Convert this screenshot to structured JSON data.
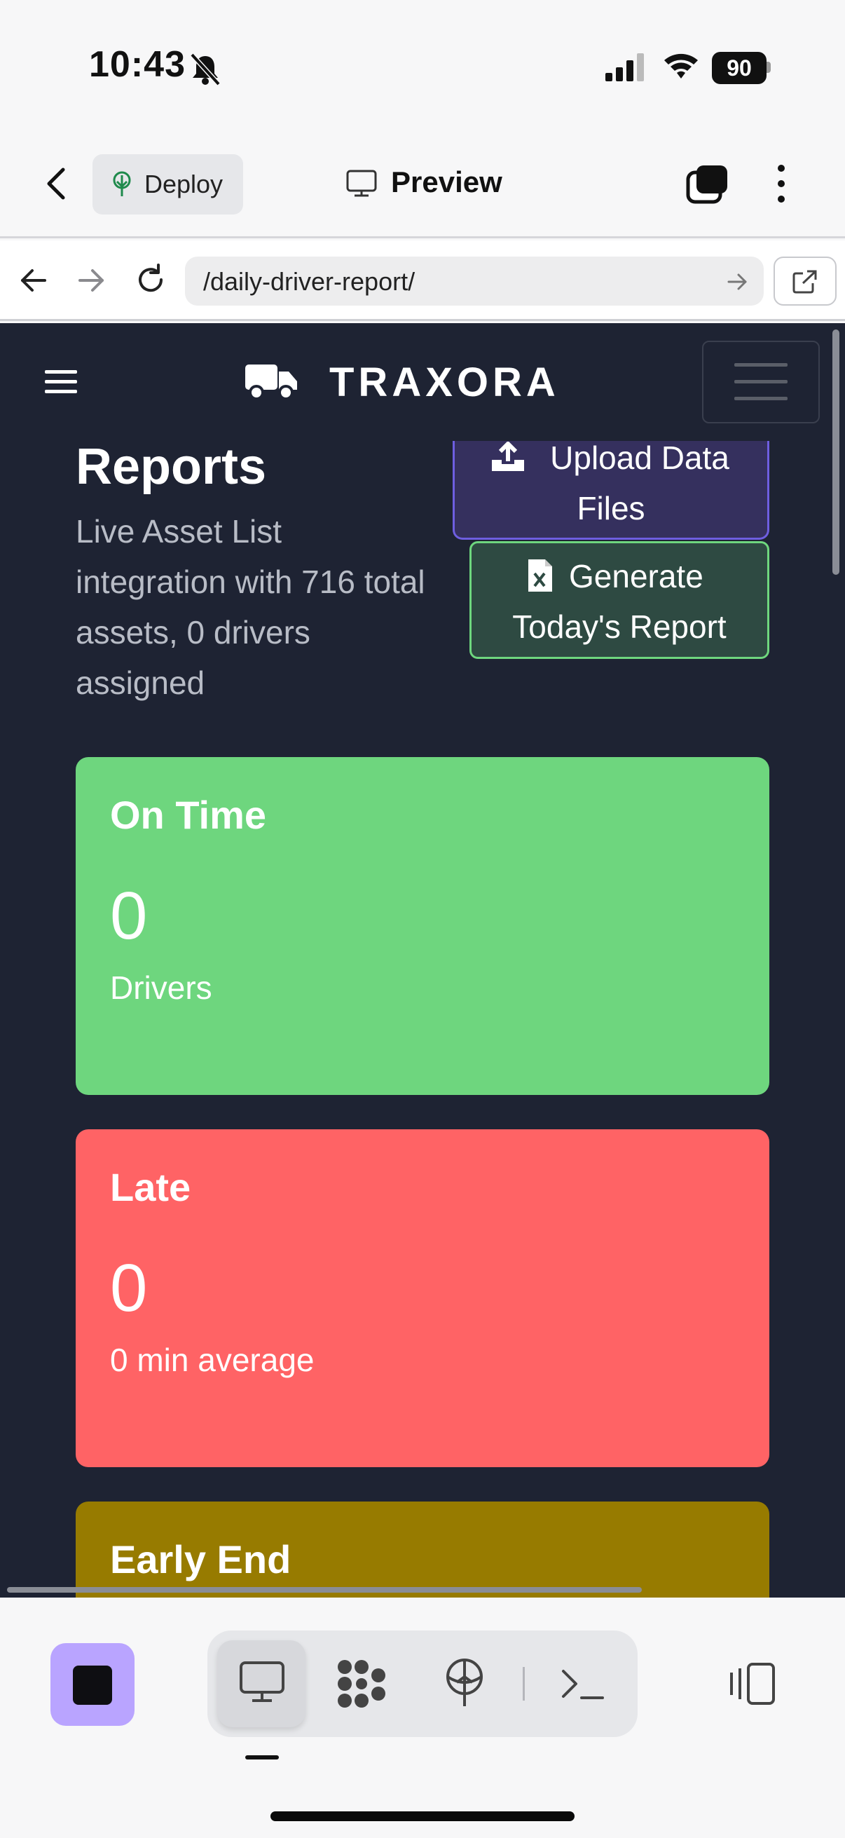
{
  "status_bar": {
    "time": "10:43",
    "battery": "90",
    "icons": [
      "bell-slash-icon",
      "cellular-signal-icon",
      "wifi-icon",
      "battery-icon"
    ]
  },
  "app_bar": {
    "deploy_label": "Deploy",
    "preview_label": "Preview"
  },
  "browser": {
    "url": "/daily-driver-report/"
  },
  "app": {
    "brand": "TRAXORA",
    "page_title": "Reports",
    "description": "Live Asset List integration with 716 total assets, 0 drivers assigned",
    "upload_button": {
      "line1": "Upload Data",
      "line2": "Files"
    },
    "generate_button": {
      "line1": "Generate",
      "line2": "Today's Report"
    },
    "cards": [
      {
        "title": "On Time",
        "value": "0",
        "subtitle": "Drivers",
        "color": "#6ed67e"
      },
      {
        "title": "Late",
        "value": "0",
        "subtitle": "0 min average",
        "color": "#ff6365"
      },
      {
        "title": "Early End",
        "color": "#977b00"
      }
    ]
  },
  "colors": {
    "app_background": "#1e2333",
    "upload_border": "#6e5ee0",
    "generate_border": "#6ed77e",
    "stop_button": "#b9a4ff"
  }
}
